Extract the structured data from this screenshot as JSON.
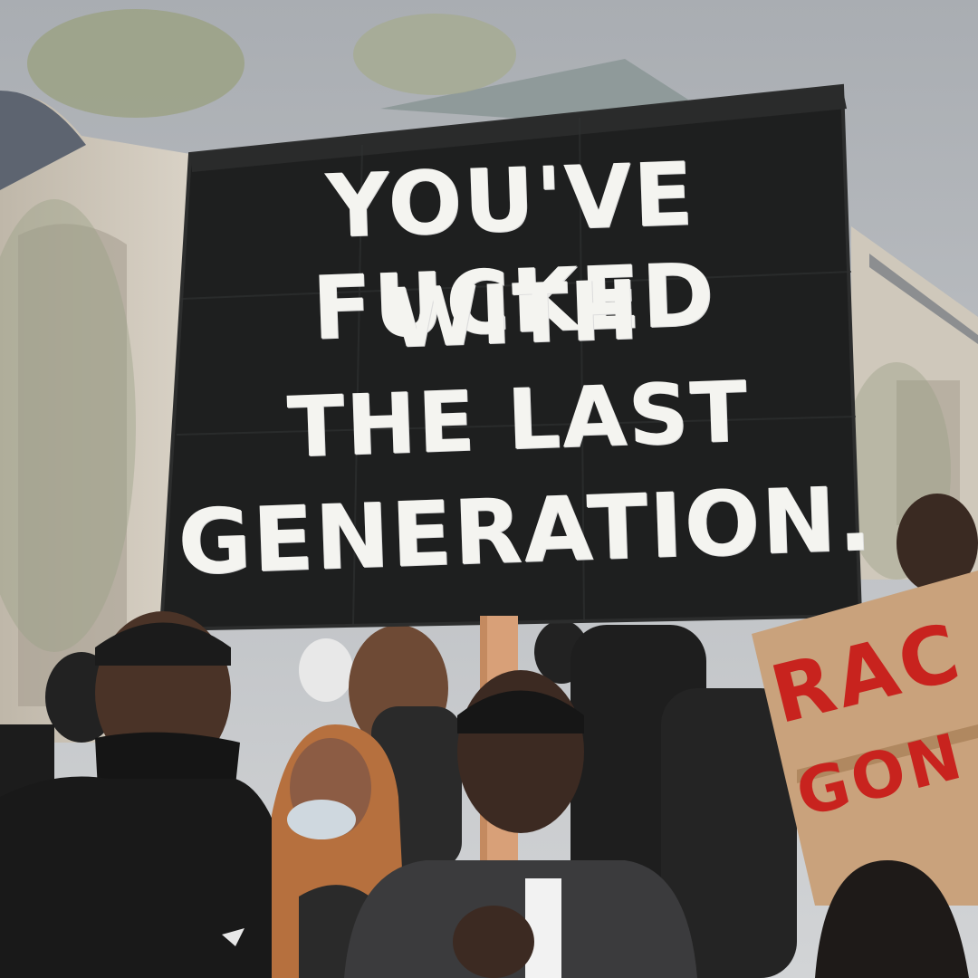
{
  "photo": {
    "subject": "protester holding handmade placard",
    "colors": {
      "sky": "#b9bcc0",
      "building": "#cfc8bb",
      "sign": "#1e1f1f",
      "paint": "#f4f4f0",
      "stick": "#d8a078",
      "cardboard": "#c9a27c",
      "red_paint": "#c8231e"
    }
  },
  "sign": {
    "line1": "YOU'VE FUCKED",
    "line2": "WITH",
    "line3": "THE LAST",
    "line4": "GENERATION."
  },
  "cardboard_sign": {
    "line1": "RAC",
    "line2": "GON"
  }
}
